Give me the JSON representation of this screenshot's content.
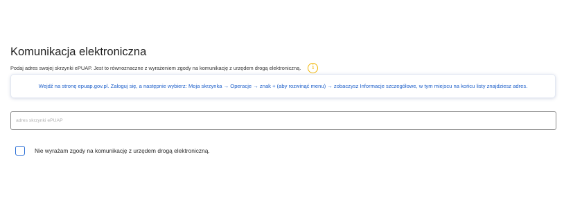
{
  "section": {
    "title": "Komunikacja elektroniczna",
    "subtitle": "Podaj adres swojej skrzynki ePUAP. Jest to równoznaczne z wyrażeniem zgody na komunikację z urzędem drogą elektroniczną.",
    "info_icon": "info-icon",
    "info_glyph": "i"
  },
  "tooltip": {
    "text": "Wejdź na stronę epuap.gov.pl. Zaloguj się, a następnie wybierz: Moja skrzynka → Operacje → znak + (aby rozwinąć menu) → zobaczysz Informacje szczegółowe, w tym miejscu na końcu listy znajdziesz adres."
  },
  "address_field": {
    "placeholder": "adres skrzynki ePUAP",
    "value": ""
  },
  "consent": {
    "label": "Nie wyrażam zgody na komunikację z urzędem drogą elektroniczną.",
    "checked": false
  },
  "colors": {
    "accent_blue": "#1a5dc9",
    "checkbox_border": "#2b6fd6",
    "info_yellow": "#f0b400"
  }
}
